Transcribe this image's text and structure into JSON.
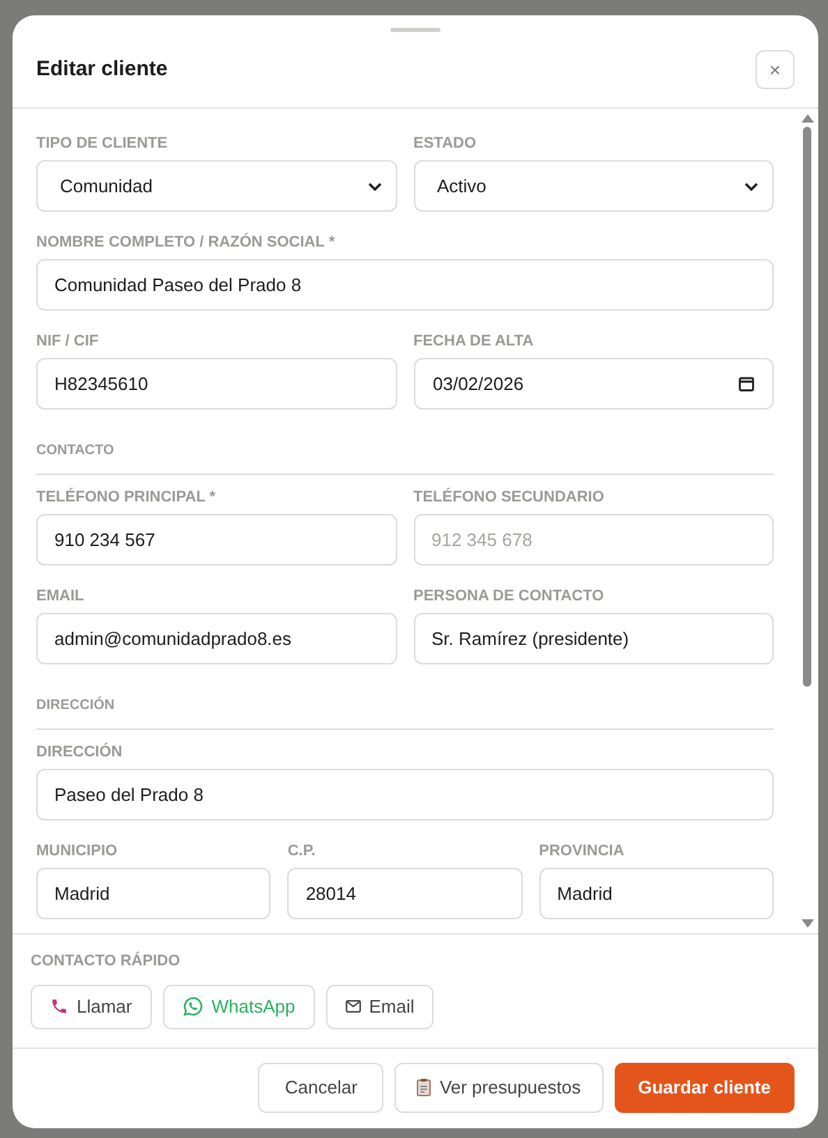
{
  "dialog": {
    "title": "Editar cliente",
    "close": "×"
  },
  "sections": [
    {
      "fields": [
        {
          "label": "TIPO DE CLIENTE",
          "kind": "select",
          "value": "Comunidad"
        },
        {
          "label": "ESTADO",
          "kind": "select",
          "value": "Activo"
        }
      ]
    },
    {
      "fields": [
        {
          "label": "NOMBRE COMPLETO / RAZÓN SOCIAL *",
          "kind": "text",
          "value": "Comunidad Paseo del Prado 8"
        }
      ]
    },
    {
      "fields": [
        {
          "label": "NIF / CIF",
          "kind": "text",
          "value": "H82345610"
        },
        {
          "label": "FECHA DE ALTA",
          "kind": "date",
          "value": "03/02/2026"
        }
      ]
    },
    {
      "heading": "CONTACTO"
    },
    {
      "fields": [
        {
          "label": "TELÉFONO PRINCIPAL *",
          "kind": "text",
          "value": "910 234 567"
        },
        {
          "label": "TELÉFONO SECUNDARIO",
          "kind": "text",
          "placeholder": "912 345 678"
        }
      ]
    },
    {
      "fields": [
        {
          "label": "EMAIL",
          "kind": "text",
          "value": "admin@comunidadprado8.es"
        },
        {
          "label": "PERSONA DE CONTACTO",
          "kind": "text",
          "value": "Sr. Ramírez (presidente)"
        }
      ]
    },
    {
      "heading": "DIRECCIÓN"
    },
    {
      "fields": [
        {
          "label": "DIRECCIÓN",
          "kind": "text",
          "value": "Paseo del Prado 8"
        }
      ]
    },
    {
      "fields": [
        {
          "label": "MUNICIPIO",
          "kind": "text",
          "value": "Madrid"
        },
        {
          "label": "C.P.",
          "kind": "text",
          "value": "28014"
        },
        {
          "label": "PROVINCIA",
          "kind": "text",
          "value": "Madrid"
        }
      ]
    }
  ],
  "quick_contact": {
    "heading": "CONTACTO RÁPIDO",
    "buttons": [
      {
        "label": "Llamar",
        "kind": "phone"
      },
      {
        "label": "WhatsApp",
        "kind": "whatsapp"
      },
      {
        "label": "Email",
        "kind": "email"
      }
    ]
  },
  "footer": {
    "buttons": [
      {
        "label": "Cancelar",
        "kind": "secondary"
      },
      {
        "label": "Ver presupuestos",
        "kind": "quotes"
      },
      {
        "label": "Guardar cliente",
        "kind": "primary"
      }
    ]
  }
}
